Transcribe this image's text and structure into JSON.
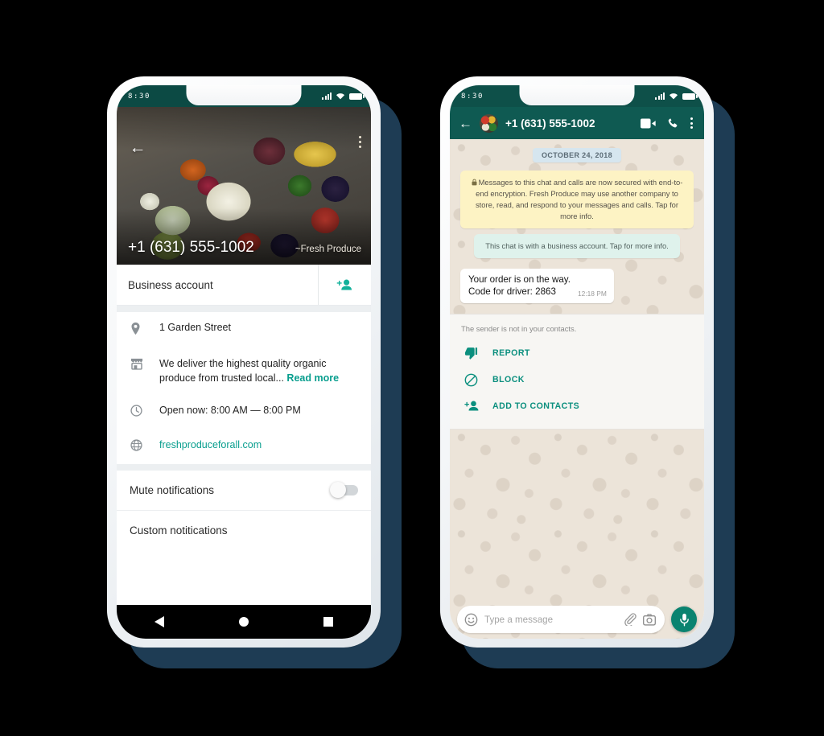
{
  "left_phone": {
    "status_bar": {
      "time": "8:30",
      "signal_icon": "signal-bars-icon",
      "wifi_icon": "wifi-icon",
      "battery_icon": "battery-icon"
    },
    "profile": {
      "back_icon": "back-arrow-icon",
      "overflow_icon": "more-vertical-icon",
      "name": "+1 (631) 555-1002",
      "push_name": "~Fresh Produce",
      "cover_photo_alt": "basket-of-vegetables-photo"
    },
    "business_row": {
      "label": "Business account",
      "action_icon": "add-contact-icon"
    },
    "info": [
      {
        "icon": "location-pin-icon",
        "text": "1 Garden Street"
      },
      {
        "icon": "storefront-icon",
        "text": "We deliver the highest quality organic produce from trusted local...",
        "link_label": "Read more"
      },
      {
        "icon": "clock-icon",
        "text": "Open now: 8:00 AM — 8:00 PM"
      },
      {
        "icon": "globe-icon",
        "text": "freshproduceforall.com",
        "is_link": true
      }
    ],
    "settings": [
      {
        "label": "Mute notifications",
        "control": "toggle",
        "state": "off"
      },
      {
        "label": "Custom notitications",
        "control": "none"
      }
    ],
    "nav_bar": {
      "back_icon": "nav-back-triangle-icon",
      "home_icon": "nav-home-circle-icon",
      "recents_icon": "nav-recents-square-icon"
    }
  },
  "right_phone": {
    "status_bar": {
      "time": "8:30",
      "signal_icon": "signal-bars-icon",
      "wifi_icon": "wifi-icon",
      "battery_icon": "battery-icon"
    },
    "header": {
      "back_icon": "back-arrow-icon",
      "avatar": "contact-avatar",
      "title": "+1 (631) 555-1002",
      "video_call_icon": "video-camera-icon",
      "voice_call_icon": "phone-icon",
      "overflow_icon": "more-vertical-icon"
    },
    "chat": {
      "date_divider": "OCTOBER 24, 2018",
      "encryption_notice": "Messages to this chat and calls are now secured with end-to-end encryption. Fresh Produce may use another company to store, read, and respond to your messages and calls. Tap for more info.",
      "encryption_icon": "lock-icon",
      "business_notice": "This chat is with a business account. Tap for more info.",
      "messages": [
        {
          "line1": "Your order is on the way.",
          "line2": "Code for driver: 2863",
          "time": "12:18 PM"
        }
      ]
    },
    "action_panel": {
      "note": "The sender is not in your contacts.",
      "items": [
        {
          "icon": "thumbs-down-icon",
          "label": "REPORT"
        },
        {
          "icon": "block-icon",
          "label": "BLOCK"
        },
        {
          "icon": "add-contact-icon",
          "label": "ADD TO CONTACTS"
        }
      ]
    },
    "composer": {
      "emoji_icon": "emoji-smiley-icon",
      "placeholder": "Type a message",
      "attach_icon": "paperclip-icon",
      "camera_icon": "camera-icon",
      "mic_icon": "microphone-icon"
    }
  },
  "colors": {
    "status_bar": "#0c4a44",
    "header_teal": "#0f5a52",
    "accent_teal": "#0b8f7e",
    "link_teal": "#089e8e",
    "chat_background": "#ece4d9",
    "encryption_notice": "#fdf3c4",
    "business_notice": "#dff2ec",
    "date_pill": "#d6e6ef",
    "shadow_navy": "#1e3c54",
    "page_background": "#000000"
  }
}
